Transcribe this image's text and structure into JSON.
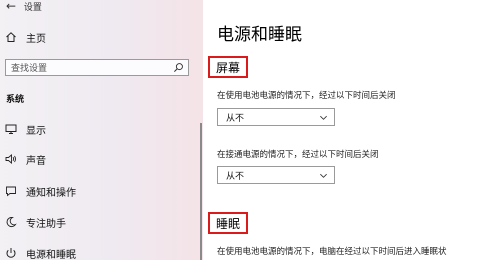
{
  "sidebar": {
    "back_symbol": "←",
    "header": "设置",
    "home_label": "主页",
    "search_placeholder": "查找设置",
    "section_label": "系统",
    "items": [
      {
        "label": "显示",
        "icon": "monitor-icon"
      },
      {
        "label": "声音",
        "icon": "speaker-icon"
      },
      {
        "label": "通知和操作",
        "icon": "notification-icon"
      },
      {
        "label": "专注助手",
        "icon": "moon-icon"
      },
      {
        "label": "电源和睡眠",
        "icon": "power-icon"
      }
    ]
  },
  "main": {
    "title": "电源和睡眠",
    "screen_section": {
      "title": "屏幕",
      "battery_label": "在使用电池电源的情况下，经过以下时间后关闭",
      "battery_value": "从不",
      "plugged_label": "在接通电源的情况下，经过以下时间后关闭",
      "plugged_value": "从不"
    },
    "sleep_section": {
      "title": "睡眠",
      "battery_label": "在使用电池电源的情况下，电脑在经过以下时间后进入睡眠状"
    }
  },
  "colors": {
    "highlight_border": "#d91b1b",
    "sidebar_bg": "#f0ecf2"
  }
}
